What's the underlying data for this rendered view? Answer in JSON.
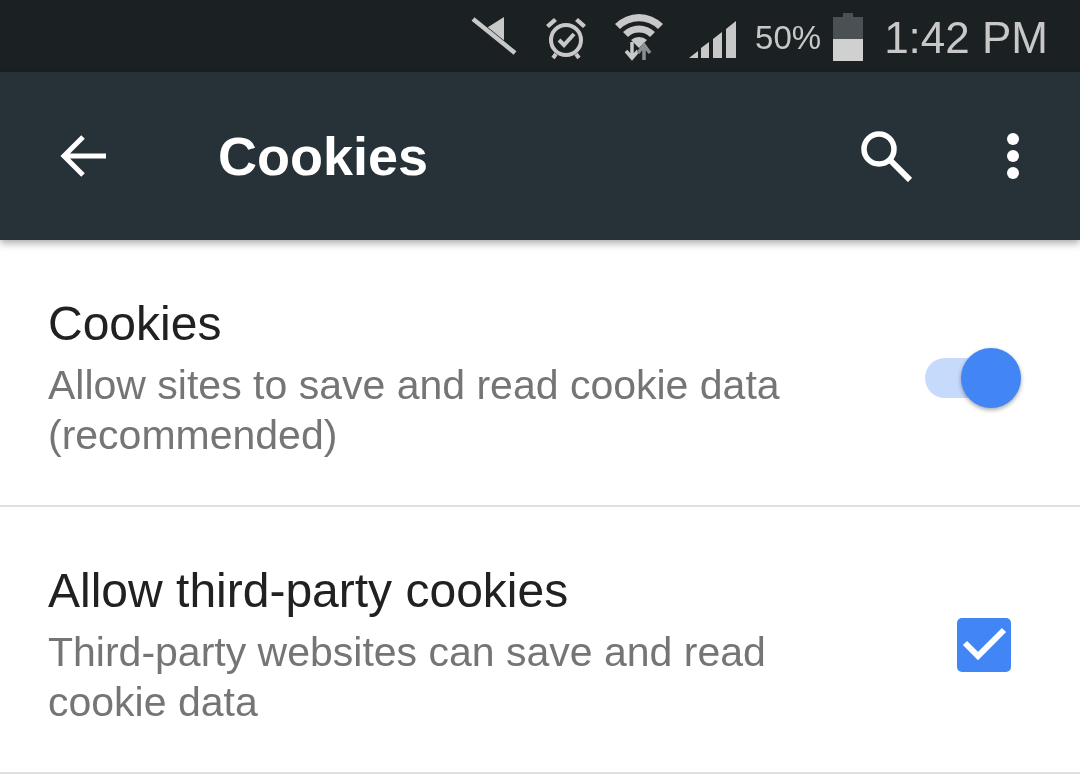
{
  "status_bar": {
    "battery_text": "50%",
    "time": "1:42 PM"
  },
  "app_bar": {
    "title": "Cookies"
  },
  "settings": [
    {
      "kind": "switch",
      "title": "Cookies",
      "summary": "Allow sites to save and read cookie data (recommended)",
      "on": true
    },
    {
      "kind": "checkbox",
      "title": "Allow third-party cookies",
      "summary": "Third-party websites can save and read cookie data",
      "checked": true
    }
  ]
}
